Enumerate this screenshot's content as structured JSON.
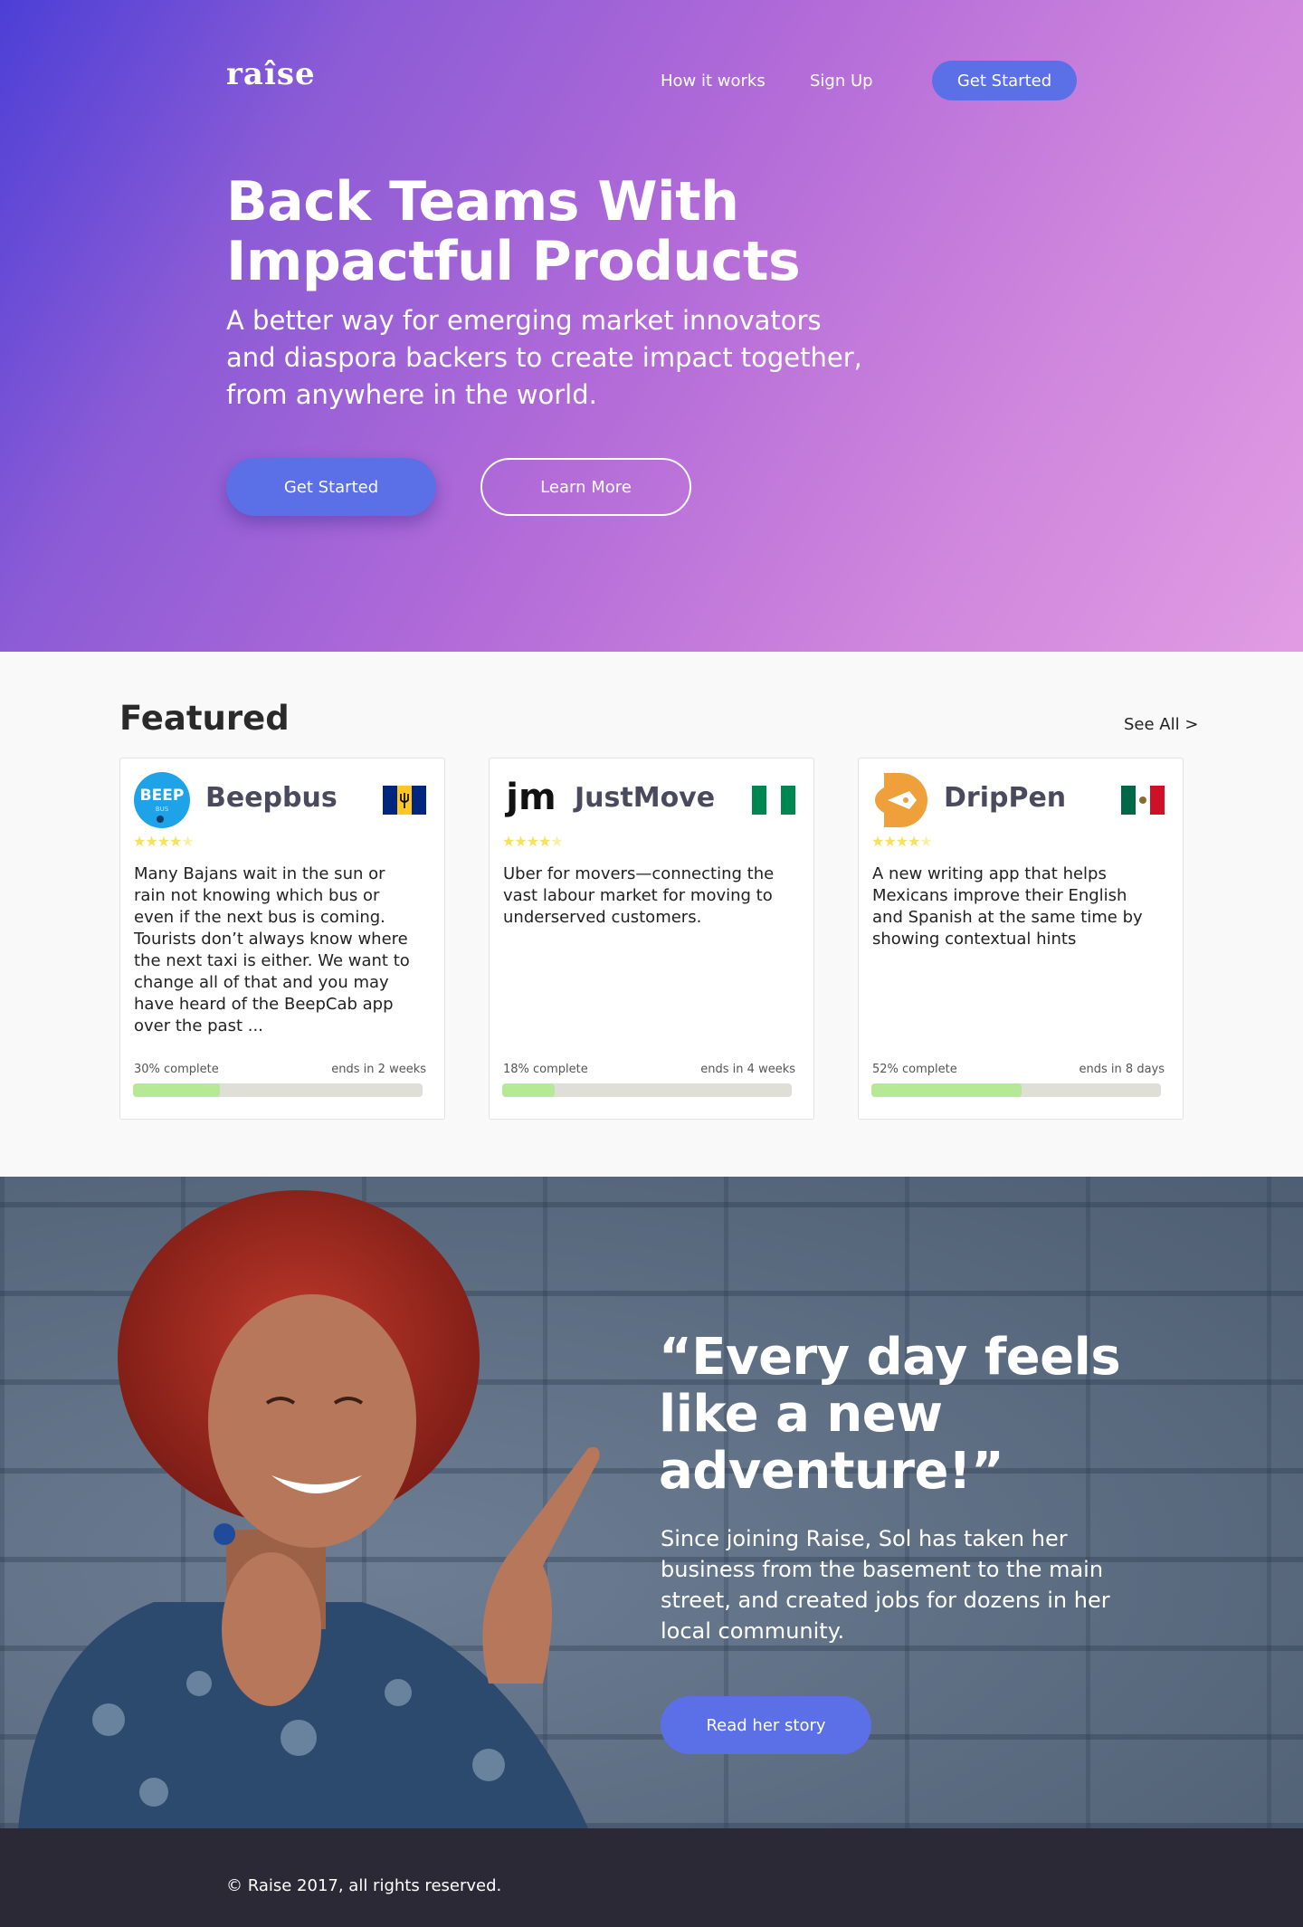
{
  "nav": {
    "logo": "raîse",
    "links": [
      "How it works",
      "Sign Up"
    ],
    "cta": "Get Started"
  },
  "hero": {
    "title": "Back Teams With Impactful Products",
    "subtitle": "A better way for emerging market innovators and diaspora backers to create impact together, from anywhere in the world.",
    "primary_button": "Get Started",
    "secondary_button": "Learn More"
  },
  "featured": {
    "title": "Featured",
    "see_all": "See All >",
    "cards": [
      {
        "name": "Beepbus",
        "logo_text": "BEEP",
        "logo_subtext": "BUS",
        "flag": "barbados-flag",
        "rating": 4.5,
        "description": "Many Bajans wait in the sun or rain not knowing which bus or even if the next bus is coming. Tourists don’t always know where the next taxi is either. We want to change all of that and you may have heard of the BeepCab app over the past ...",
        "percent_label": "30% complete",
        "progress": 0.3,
        "ends": "ends in 2 weeks"
      },
      {
        "name": "JustMove",
        "logo_text": "jm",
        "flag": "nigeria-flag",
        "rating": 4.5,
        "description": "Uber for movers—connecting the vast labour market for moving to underserved customers.",
        "percent_label": "18% complete",
        "progress": 0.18,
        "ends": "ends in 4 weeks"
      },
      {
        "name": "DripPen",
        "flag": "mexico-flag",
        "rating": 4.5,
        "description": "A new writing app that helps Mexicans improve their English and Spanish at the same time by showing contextual hints",
        "percent_label": "52% complete",
        "progress": 0.52,
        "ends": "ends in 8 days"
      }
    ]
  },
  "testimonial": {
    "quote": "“Every day feels like a new adventure!”",
    "story": "Since joining Raise, Sol has taken her business from the basement to the main street, and created jobs for dozens in her local community.",
    "button": "Read her story"
  },
  "footer": {
    "copyright": "© Raise 2017, all rights reserved."
  },
  "colors": {
    "accent": "#5b6fe6",
    "progress_fill": "#b6e996",
    "star": "#f5e15a",
    "footer_bg": "#2a2935"
  }
}
